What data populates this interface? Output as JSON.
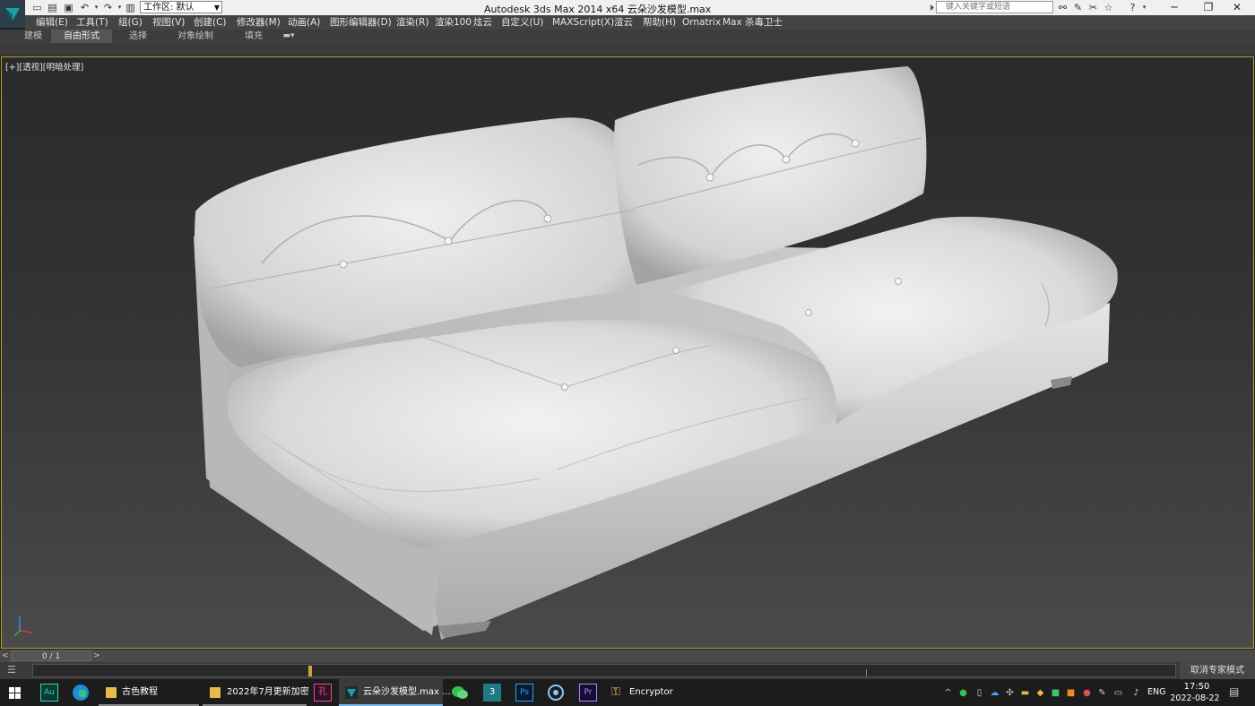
{
  "title_bar": {
    "window_title": "Autodesk 3ds Max  2014 x64      云朵沙发模型.max",
    "workspace_label": "工作区: 默认",
    "search_placeholder": "键入关键字或短语"
  },
  "menu": {
    "items": [
      "编辑(E)",
      "工具(T)",
      "组(G)",
      "视图(V)",
      "创建(C)",
      "修改器(M)",
      "动画(A)",
      "图形编辑器(D)",
      "渲染(R)",
      "渲染100",
      "炫云",
      "自定义(U)",
      "MAXScript(X)",
      "渲云",
      "帮助(H)",
      "Ornatrix",
      "Max 杀毒卫士"
    ]
  },
  "ribbon": {
    "tabs": [
      "建模",
      "自由形式",
      "选择",
      "对象绘制",
      "填充"
    ],
    "active_tab": "自由形式"
  },
  "viewport": {
    "label_plus": "[+]",
    "label_view": "[透视]",
    "label_shading": "[明暗处理]",
    "border_color": "#b9a12a",
    "object": "sofa-model"
  },
  "timeslider": {
    "frame_counter": "0 / 1",
    "prev_label": "<",
    "next_label": ">"
  },
  "trackbar": {
    "expert_mode_label": "取消专家模式"
  },
  "taskbar": {
    "apps": [
      {
        "name": "audition",
        "label": ""
      },
      {
        "name": "edge",
        "label": ""
      },
      {
        "name": "folder-1",
        "label": "古色教程"
      },
      {
        "name": "folder-2",
        "label": "2022年7月更新加密"
      },
      {
        "name": "app-pink",
        "label": ""
      },
      {
        "name": "3dsmax-window",
        "label": "云朵沙发模型.max ..."
      },
      {
        "name": "wechat",
        "label": ""
      },
      {
        "name": "3dsmax-app",
        "label": ""
      },
      {
        "name": "photoshop",
        "label": "Ps"
      },
      {
        "name": "app-circle",
        "label": ""
      },
      {
        "name": "premiere",
        "label": "Pr"
      },
      {
        "name": "encryptor",
        "label": "Encryptor"
      }
    ],
    "language": "ENG",
    "time": "17:50",
    "date": "2022-08-22"
  }
}
